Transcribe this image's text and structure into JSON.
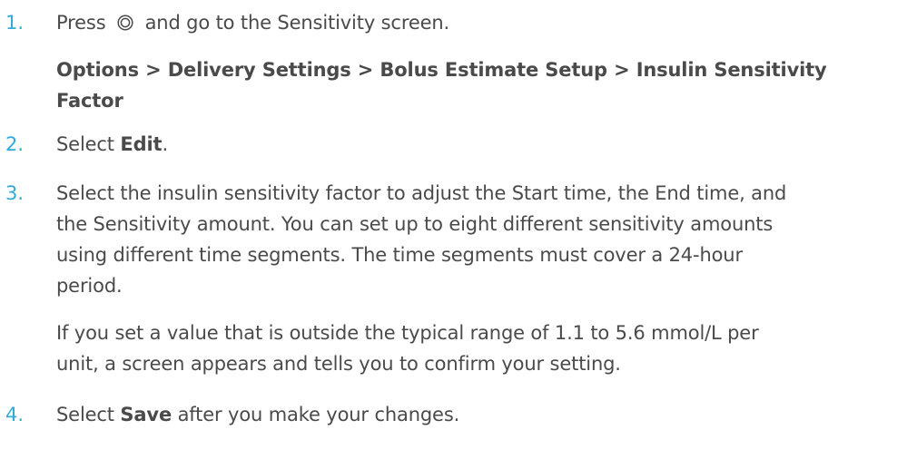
{
  "steps": [
    {
      "number": "1.",
      "text_before_icon": "Press",
      "icon": "select-button-icon",
      "text_after_icon": "and go to the Sensitivity screen.",
      "menu_path_line1": "Options > Delivery Settings > Bolus Estimate Setup > Insulin Sensitivity",
      "menu_path_line2": "Factor"
    },
    {
      "number": "2.",
      "prefix": "Select",
      "bold": "Edit",
      "suffix": "."
    },
    {
      "number": "3.",
      "lines": [
        "Select the insulin sensitivity factor to adjust the Start time, the End time, and",
        "the Sensitivity amount. You can set up to eight different sensitivity amounts",
        "using different time segments. The time segments must cover a 24-hour",
        "period."
      ],
      "note_lines": [
        "If you set a value that is outside the typical range of 1.1 to 5.6 mmol/L per",
        "unit, a screen appears and tells you to confirm your setting."
      ]
    },
    {
      "number": "4.",
      "prefix": "Select",
      "bold": "Save",
      "suffix": "after you make your changes."
    }
  ],
  "colors": {
    "number_accent": "#35a9dc",
    "body_text": "#4a4a4a"
  }
}
